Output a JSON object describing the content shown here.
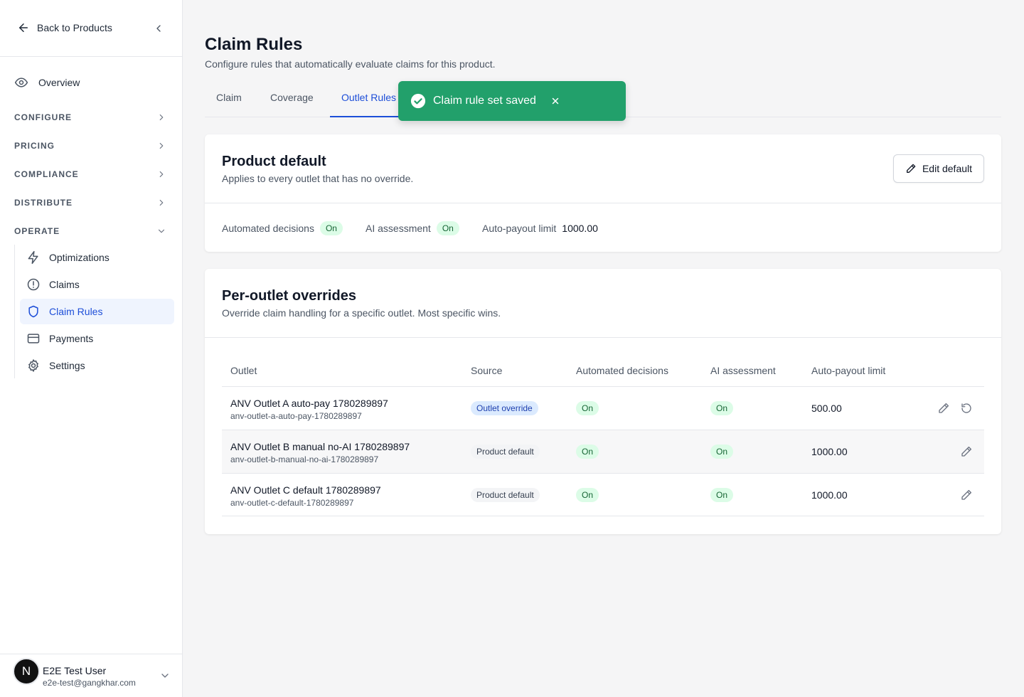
{
  "sidebar": {
    "back_label": "Back to Products",
    "overview_label": "Overview",
    "sections": {
      "configure": "CONFIGURE",
      "pricing": "PRICING",
      "compliance": "COMPLIANCE",
      "distribute": "DISTRIBUTE",
      "operate": "OPERATE"
    },
    "operate_items": {
      "optimizations": "Optimizations",
      "claims": "Claims",
      "claim_rules": "Claim Rules",
      "payments": "Payments",
      "settings": "Settings"
    },
    "active_item": "Claim Rules",
    "user": {
      "initial": "N",
      "name": "E2E Test User",
      "email": "e2e-test@gangkhar.com"
    }
  },
  "page": {
    "title": "Claim Rules",
    "subtitle": "Configure rules that automatically evaluate claims for this product.",
    "tabs": {
      "claim": "Claim",
      "coverage": "Coverage",
      "outlet_rules": "Outlet Rules"
    },
    "active_tab": "Outlet Rules"
  },
  "toast": {
    "message": "Claim rule set saved",
    "color": "#22a06b"
  },
  "product_default": {
    "title": "Product default",
    "subtitle": "Applies to every outlet that has no override.",
    "edit_label": "Edit default",
    "automated_label": "Automated decisions",
    "automated_value": "On",
    "ai_label": "AI assessment",
    "ai_value": "On",
    "limit_label": "Auto-payout limit",
    "limit_value": "1000.00"
  },
  "overrides": {
    "title": "Per-outlet overrides",
    "subtitle": "Override claim handling for a specific outlet. Most specific wins.",
    "headers": {
      "outlet": "Outlet",
      "source": "Source",
      "automated": "Automated decisions",
      "ai": "AI assessment",
      "limit": "Auto-payout limit"
    },
    "rows": [
      {
        "name": "ANV Outlet A auto-pay 1780289897",
        "slug": "anv-outlet-a-auto-pay-1780289897",
        "source": "Outlet override",
        "automated": "On",
        "ai": "On",
        "limit": "500.00"
      },
      {
        "name": "ANV Outlet B manual no-AI 1780289897",
        "slug": "anv-outlet-b-manual-no-ai-1780289897",
        "source": "Product default",
        "automated": "On",
        "ai": "On",
        "limit": "1000.00"
      },
      {
        "name": "ANV Outlet C default 1780289897",
        "slug": "anv-outlet-c-default-1780289897",
        "source": "Product default",
        "automated": "On",
        "ai": "On",
        "limit": "1000.00"
      }
    ]
  },
  "colors": {
    "accent": "#1d4ed8",
    "success": "#22a06b"
  }
}
